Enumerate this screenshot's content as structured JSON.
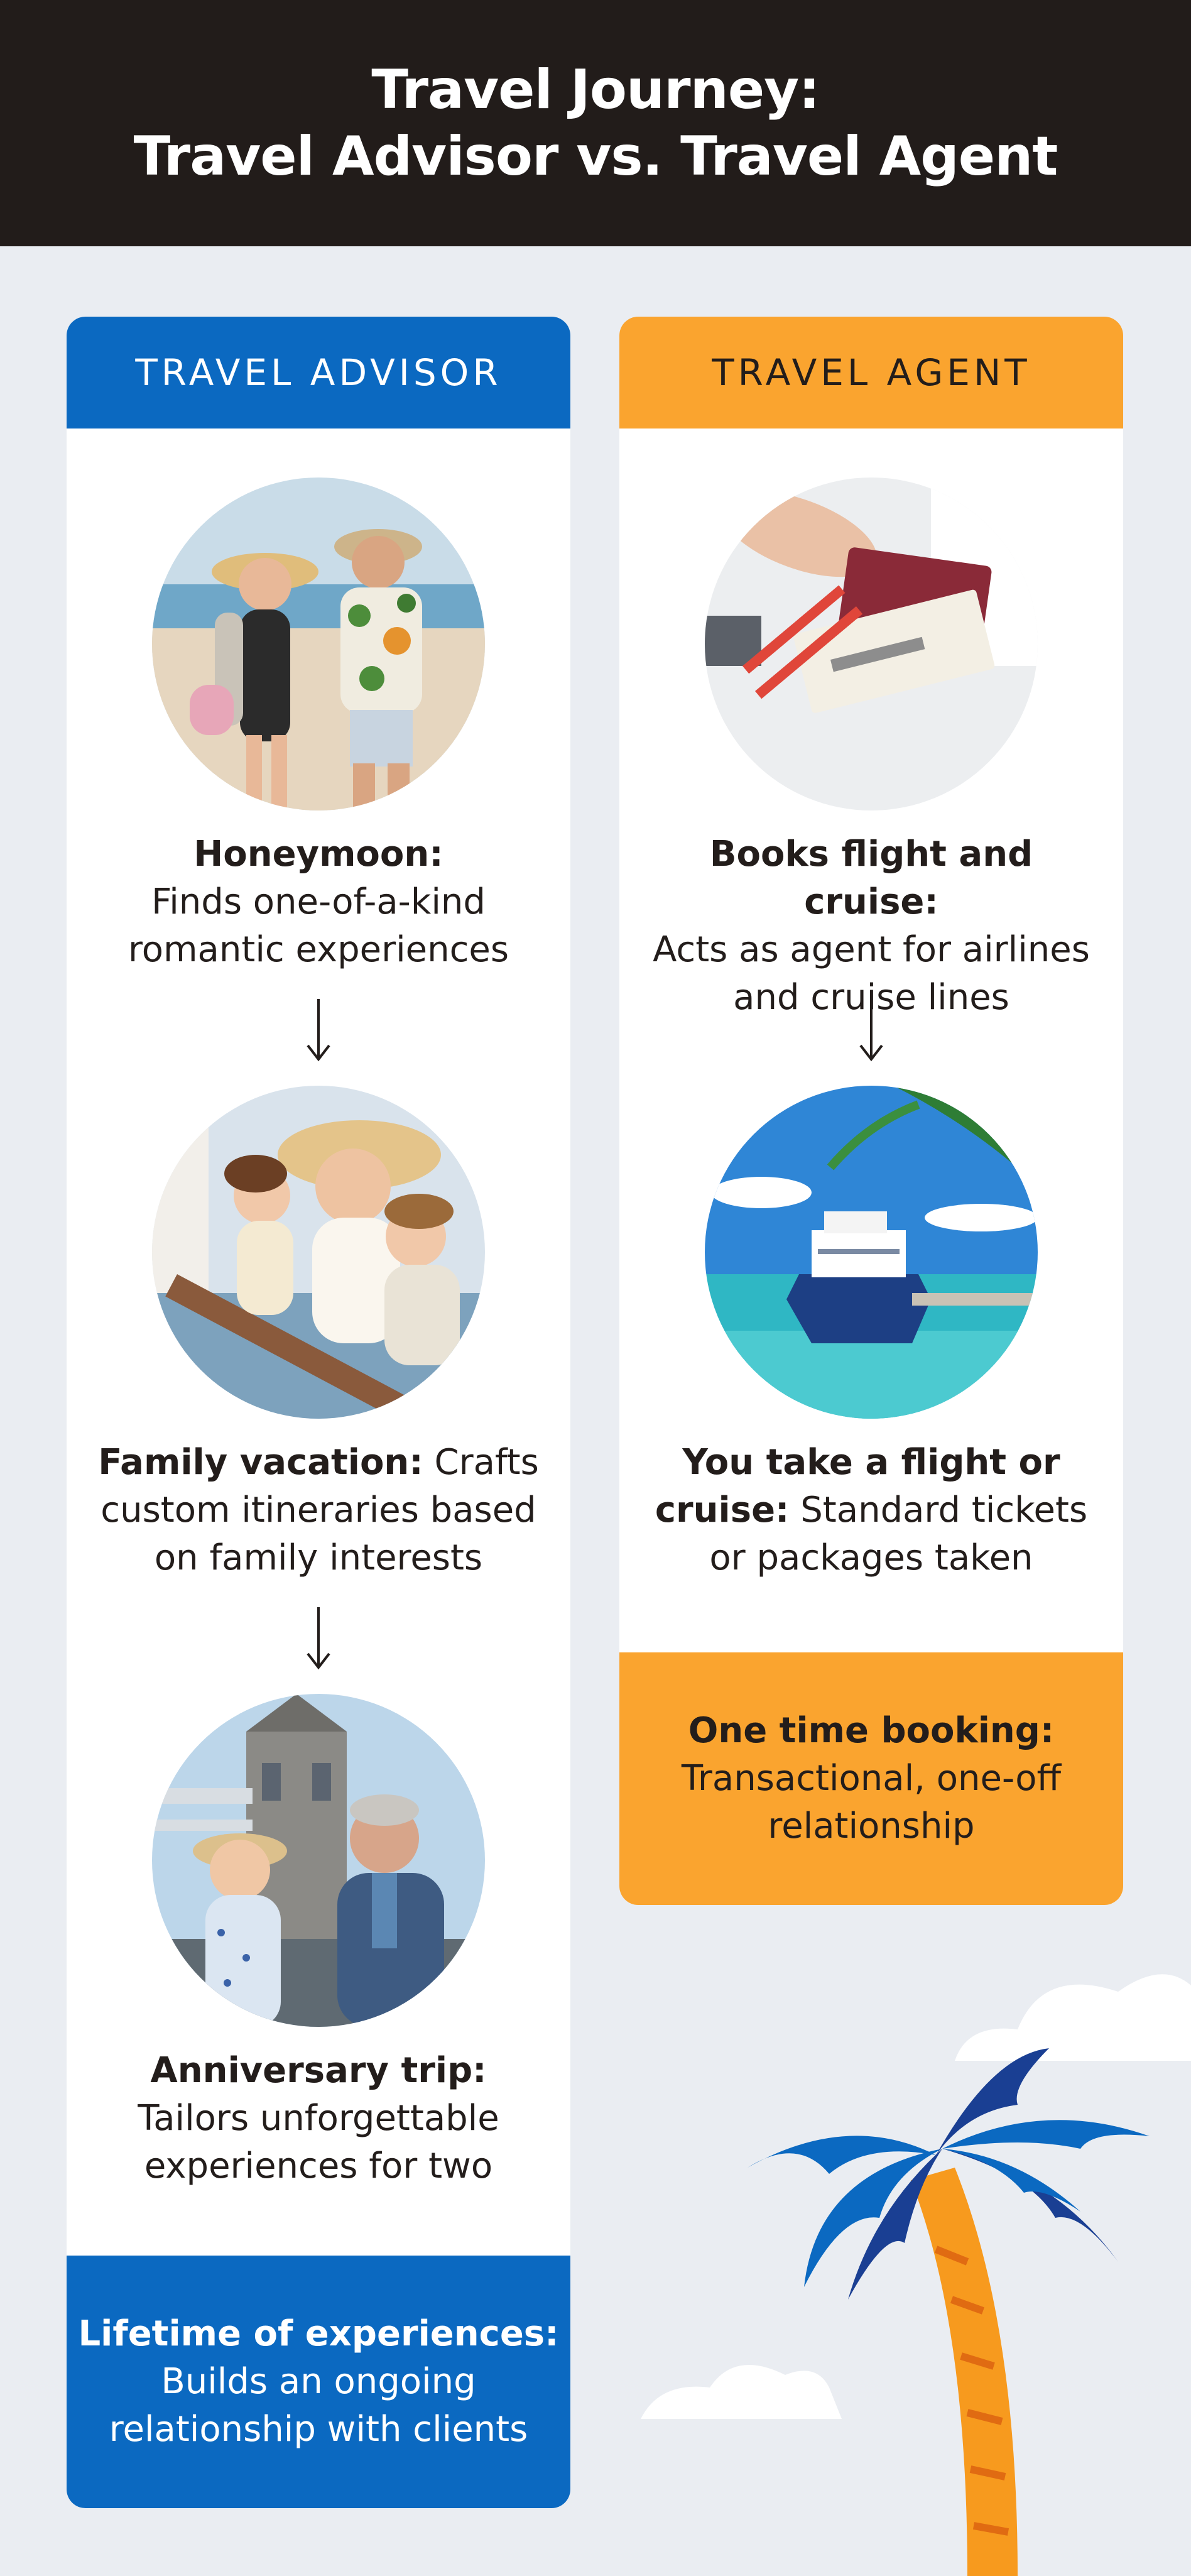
{
  "header": {
    "title_line1": "Travel Journey:",
    "title_line2": "Travel Advisor vs. Travel Agent"
  },
  "advisor": {
    "heading": "TRAVEL ADVISOR",
    "steps": [
      {
        "title": "Honeymoon:",
        "line1": "Finds one-of-a-kind",
        "line2": "romantic experiences"
      },
      {
        "title": "Family vacation:",
        "title_rest": " Crafts",
        "line1": "custom itineraries based",
        "line2": "on family interests"
      },
      {
        "title": "Anniversary trip:",
        "line1": "Tailors unforgettable",
        "line2": "experiences for two"
      }
    ],
    "footer": {
      "title": "Lifetime of experiences:",
      "line1": "Builds an ongoing",
      "line2": "relationship with clients"
    }
  },
  "agent": {
    "heading": "TRAVEL AGENT",
    "steps": [
      {
        "title": "Books flight and cruise:",
        "line1": "Acts as agent for airlines",
        "line2": "and cruise lines"
      },
      {
        "title": "You take a flight or",
        "title2": "cruise:",
        "title2_rest": " Standard tickets",
        "line2": "or packages taken"
      }
    ],
    "footer": {
      "title": "One time booking:",
      "line1": "Transactional, one-off",
      "line2": "relationship"
    }
  },
  "colors": {
    "header_bg": "#221c1a",
    "page_bg": "#eaedf2",
    "advisor_blue": "#0b69c1",
    "agent_orange": "#faa42f",
    "text_dark": "#231d1b"
  },
  "icons": {
    "arrow": "down-arrow-icon",
    "palm": "palm-tree-illustration",
    "cloud": "cloud-illustration"
  }
}
